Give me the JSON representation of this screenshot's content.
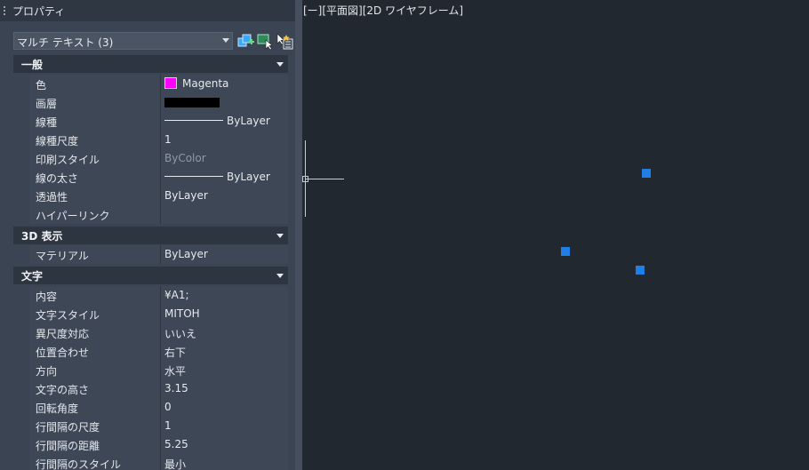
{
  "palette": {
    "title": "プロパティ",
    "selector": {
      "value": "マルチ テキスト (3)"
    },
    "toolbar": {
      "toggle_icon": "toggle-pickadd-icon",
      "select_icon": "select-objects-icon",
      "quick_select_icon": "quick-select-icon"
    }
  },
  "general": {
    "title": "一般",
    "rows": [
      {
        "label": "色",
        "value": "Magenta",
        "swatch": "#ff00ff"
      },
      {
        "label": "画層",
        "value": ""
      },
      {
        "label": "線種",
        "value": "ByLayer"
      },
      {
        "label": "線種尺度",
        "value": "1"
      },
      {
        "label": "印刷スタイル",
        "value": "ByColor"
      },
      {
        "label": "線の太さ",
        "value": "ByLayer"
      },
      {
        "label": "透過性",
        "value": "ByLayer"
      },
      {
        "label": "ハイパーリンク",
        "value": ""
      }
    ]
  },
  "display3d": {
    "title": "3D 表示",
    "rows": [
      {
        "label": "マテリアル",
        "value": "ByLayer"
      }
    ]
  },
  "text": {
    "title": "文字",
    "rows": [
      {
        "label": "内容",
        "value": "¥A1;"
      },
      {
        "label": "文字スタイル",
        "value": "MITOH"
      },
      {
        "label": "異尺度対応",
        "value": "いいえ"
      },
      {
        "label": "位置合わせ",
        "value": "右下"
      },
      {
        "label": "方向",
        "value": "水平"
      },
      {
        "label": "文字の高さ",
        "value": "3.15"
      },
      {
        "label": "回転角度",
        "value": "0"
      },
      {
        "label": "行間隔の尺度",
        "value": "1"
      },
      {
        "label": "行間隔の距離",
        "value": "5.25"
      },
      {
        "label": "行間隔のスタイル",
        "value": "最小"
      }
    ]
  },
  "viewport": {
    "label": "[ー][平面図][2D ワイヤフレーム]",
    "grip_color": "#1f7fe6"
  }
}
